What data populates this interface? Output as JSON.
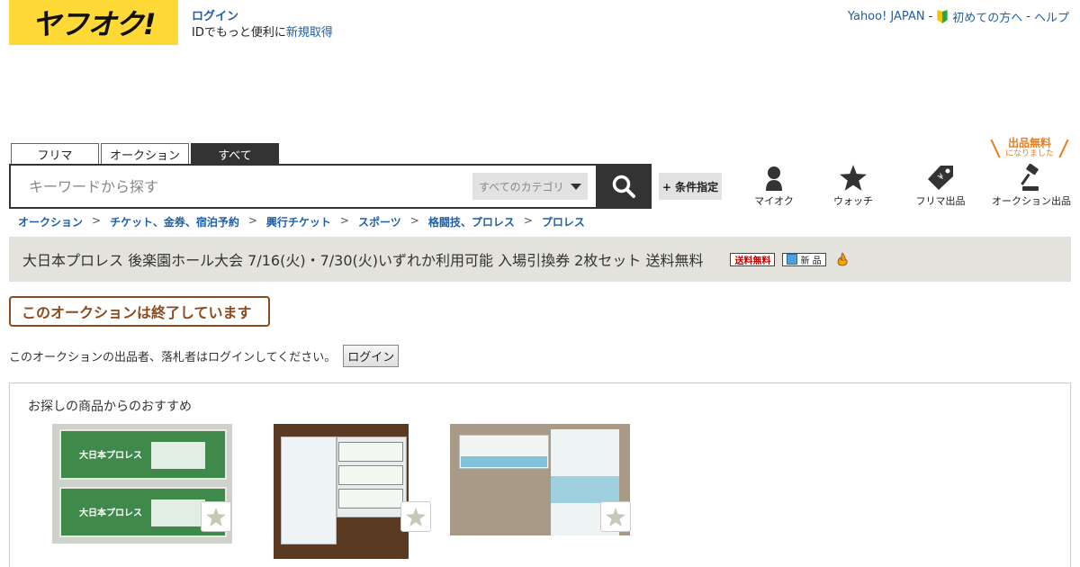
{
  "header": {
    "logo_text": "ヤフオク!",
    "login_link": "ログイン",
    "login_desc": "IDでもっと便利に",
    "signup_link": "新規取得",
    "top_links": {
      "yahoo": "Yahoo! JAPAN",
      "sep1": "-",
      "beginner": "初めての方へ",
      "sep2": "-",
      "help": "ヘルプ"
    }
  },
  "search": {
    "tabs": [
      "フリマ",
      "オークション",
      "すべて"
    ],
    "active_tab": "すべて",
    "placeholder": "キーワードから探す",
    "category": "すべてのカテゴリ",
    "condition_label": "+ 条件指定"
  },
  "nav": {
    "myauction": "マイオク",
    "watch": "ウォッチ",
    "flea_sell": "フリマ出品",
    "auction_sell": "オークション出品",
    "promo_line1": "出品無料",
    "promo_line2": "になりました"
  },
  "breadcrumb": [
    "オークション",
    "チケット、金券、宿泊予約",
    "興行チケット",
    "スポーツ",
    "格闘技、プロレス",
    "プロレス"
  ],
  "breadcrumb_sep": ">",
  "item": {
    "title": "大日本プロレス 後楽園ホール大会 7/16(火)・7/30(火)いずれか利用可能 入場引換券 2枚セット 送料無料",
    "badge_shipping": "送料無料",
    "badge_new": "新 品"
  },
  "status": {
    "ended": "このオークションは終了しています",
    "login_note": "このオークションの出品者、落札者はログインしてください。",
    "login_button": "ログイン"
  },
  "recommendations": {
    "title": "お探しの商品からのおすすめ",
    "thumb1_text": "大日本プロレス"
  },
  "colors": {
    "brand_yellow": "#ffd935",
    "link_blue": "#1e5fa8",
    "ended_brown": "#8a4b1f",
    "title_bar": "#e3e2dc"
  }
}
